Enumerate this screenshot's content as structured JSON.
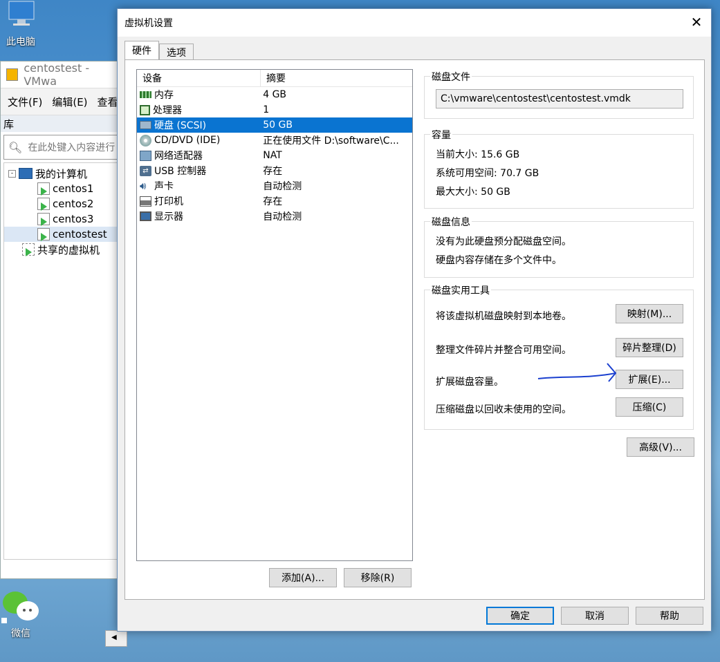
{
  "desktop": {
    "this_pc_label": "此电脑",
    "wechat_label": "微信"
  },
  "vmware": {
    "title": "centostest - VMwa",
    "menu": [
      "文件(F)",
      "编辑(E)",
      "查看"
    ],
    "library_label": "库",
    "search_placeholder": "在此处键入内容进行",
    "tree": {
      "root": "我的计算机",
      "vms": [
        "centos1",
        "centos2",
        "centos3",
        "centostest"
      ],
      "shared": "共享的虚拟机"
    }
  },
  "dialog": {
    "title": "虚拟机设置",
    "tabs": [
      "硬件",
      "选项"
    ],
    "columns": [
      "设备",
      "摘要"
    ],
    "devices": [
      {
        "name": "内存",
        "summary": "4 GB",
        "icon": "memory-icon"
      },
      {
        "name": "处理器",
        "summary": "1",
        "icon": "cpu-icon"
      },
      {
        "name": "硬盘 (SCSI)",
        "summary": "50 GB",
        "icon": "harddisk-icon",
        "selected": true
      },
      {
        "name": "CD/DVD (IDE)",
        "summary": "正在使用文件 D:\\software\\C...",
        "icon": "cd-icon"
      },
      {
        "name": "网络适配器",
        "summary": "NAT",
        "icon": "network-icon"
      },
      {
        "name": "USB 控制器",
        "summary": "存在",
        "icon": "usb-icon"
      },
      {
        "name": "声卡",
        "summary": "自动检测",
        "icon": "sound-icon"
      },
      {
        "name": "打印机",
        "summary": "存在",
        "icon": "printer-icon"
      },
      {
        "name": "显示器",
        "summary": "自动检测",
        "icon": "display-icon"
      }
    ],
    "add_button": "添加(A)...",
    "remove_button": "移除(R)",
    "disk_file": {
      "title": "磁盘文件",
      "path": "C:\\vmware\\centostest\\centostest.vmdk"
    },
    "capacity": {
      "title": "容量",
      "current": "当前大小: 15.6 GB",
      "available": "系统可用空间: 70.7 GB",
      "max": "最大大小: 50 GB"
    },
    "disk_info": {
      "title": "磁盘信息",
      "line1": "没有为此硬盘预分配磁盘空间。",
      "line2": "硬盘内容存储在多个文件中。"
    },
    "utilities": {
      "title": "磁盘实用工具",
      "map_text": "将该虚拟机磁盘映射到本地卷。",
      "map_button": "映射(M)...",
      "defrag_text": "整理文件碎片并整合可用空间。",
      "defrag_button": "碎片整理(D)",
      "expand_text": "扩展磁盘容量。",
      "expand_button": "扩展(E)...",
      "compact_text": "压缩磁盘以回收未使用的空间。",
      "compact_button": "压缩(C)"
    },
    "advanced_button": "高级(V)...",
    "ok_button": "确定",
    "cancel_button": "取消",
    "help_button": "帮助"
  }
}
